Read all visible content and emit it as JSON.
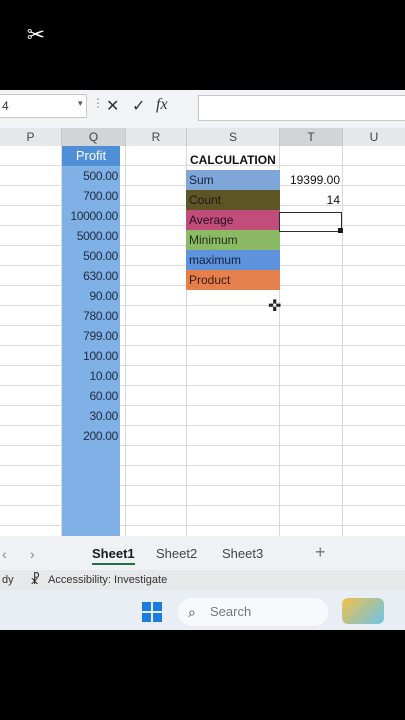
{
  "formula_bar": {
    "name_box": "4",
    "cancel_icon": "✕",
    "enter_icon": "✓",
    "fx_label": "fx"
  },
  "columns": [
    "P",
    "Q",
    "R",
    "S",
    "T",
    "U"
  ],
  "profit": {
    "header": "Profit",
    "values": [
      "500.00",
      "700.00",
      "10000.00",
      "5000.00",
      "500.00",
      "630.00",
      "90.00",
      "780.00",
      "799.00",
      "100.00",
      "10.00",
      "60.00",
      "30.00",
      "200.00"
    ]
  },
  "calculation": {
    "header": "CALCULATION",
    "rows": [
      {
        "label": "Sum",
        "color": "#7fa6d9",
        "text_color": "#16233a",
        "value": "19399.00"
      },
      {
        "label": "Count",
        "color": "#5e5524",
        "text_color": "#1a1a1a",
        "value": "14"
      },
      {
        "label": "Average",
        "color": "#c04d7a",
        "text_color": "#2a0f1c",
        "value": ""
      },
      {
        "label": "Minimum",
        "color": "#8cba64",
        "text_color": "#1f2e12",
        "value": ""
      },
      {
        "label": "maximum",
        "color": "#5f92dd",
        "text_color": "#0f1f3c",
        "value": ""
      },
      {
        "label": "Product",
        "color": "#e5804d",
        "text_color": "#3a180a",
        "value": ""
      }
    ]
  },
  "sheets": [
    "Sheet1",
    "Sheet2",
    "Sheet3"
  ],
  "status": {
    "ready": "dy",
    "accessibility": "Accessibility: Investigate"
  },
  "taskbar": {
    "search_placeholder": "Search"
  }
}
